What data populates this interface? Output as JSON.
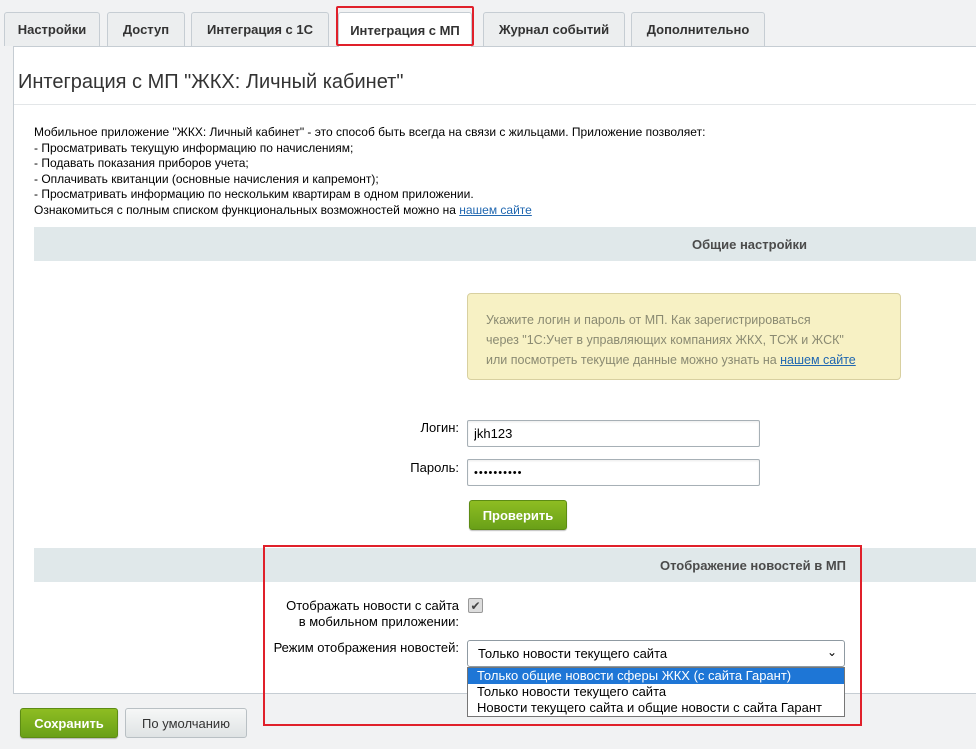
{
  "tabs": [
    {
      "label": "Настройки"
    },
    {
      "label": "Доступ"
    },
    {
      "label": "Интеграция с 1С"
    },
    {
      "label": "Интеграция с МП"
    },
    {
      "label": "Журнал событий"
    },
    {
      "label": "Дополнительно"
    }
  ],
  "active_tab": "Интеграция с МП",
  "page": {
    "title": "Интеграция с МП \"ЖКХ: Личный кабинет\"",
    "intro": {
      "lines": [
        "Мобильное приложение \"ЖКХ: Личный кабинет\" - это способ быть всегда на связи с жильцами. Приложение позволяет:",
        "- Просматривать текущую информацию по начислениям;",
        "- Подавать показания приборов учета;",
        "- Оплачивать квитанции (основные начисления и капремонт);",
        "- Просматривать информацию по нескольким квартирам в одном приложении."
      ],
      "last_line_text": "Ознакомиться с полным списком функциональных возможностей можно на ",
      "last_line_link": "нашем сайте"
    }
  },
  "general": {
    "heading": "Общие настройки",
    "hint": {
      "line1": "Укажите логин и пароль от МП. Как зарегистрироваться",
      "line2": "через \"1С:Учет в управляющих компаниях ЖКХ, ТСЖ и ЖСК\"",
      "line3_text": "или посмотреть текущие данные можно узнать на ",
      "line3_link": "нашем сайте"
    },
    "login_label": "Логин:",
    "login_value": "jkh123",
    "password_label": "Пароль:",
    "password_value": "••••••••••",
    "check_button": "Проверить"
  },
  "news": {
    "heading": "Отображение новостей в МП",
    "show_label_line1": "Отображать новости с сайта",
    "show_label_line2": "в мобильном приложении:",
    "show_checked": true,
    "mode_label": "Режим отображения новостей:",
    "mode_selected": "Только новости текущего сайта",
    "options": [
      "Только общие новости сферы ЖКХ (с сайта Гарант)",
      "Только новости текущего сайта",
      "Новости текущего сайта и общие новости с сайта Гарант"
    ],
    "highlighted_option_index": 0
  },
  "footer": {
    "save_button": "Сохранить",
    "default_button": "По умолчанию"
  },
  "colors": {
    "accent_green": "#7ab01d",
    "highlight_red": "#e0202a",
    "link_blue": "#2067b0",
    "option_selected_blue": "#1e76d6",
    "section_bg": "#e0e8ea",
    "hint_bg": "#f7f1c4"
  },
  "icons": {
    "checkbox": "checkmark-icon",
    "select_caret": "chevron-down-icon"
  }
}
